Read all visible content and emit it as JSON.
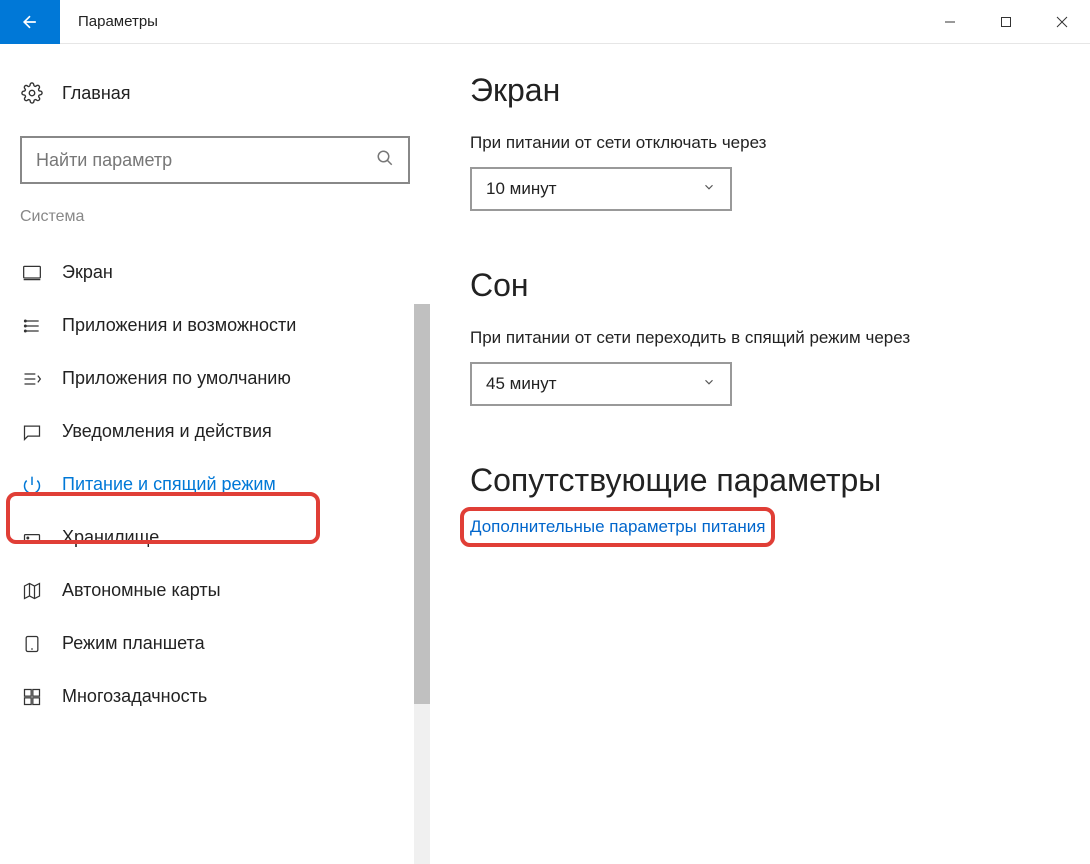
{
  "window": {
    "title": "Параметры"
  },
  "sidebar": {
    "home": "Главная",
    "search_placeholder": "Найти параметр",
    "category": "Система",
    "items": [
      {
        "label": "Экран"
      },
      {
        "label": "Приложения и возможности"
      },
      {
        "label": "Приложения по умолчанию"
      },
      {
        "label": "Уведомления и действия"
      },
      {
        "label": "Питание и спящий режим"
      },
      {
        "label": "Хранилище"
      },
      {
        "label": "Автономные карты"
      },
      {
        "label": "Режим планшета"
      },
      {
        "label": "Многозадачность"
      }
    ]
  },
  "main": {
    "screen": {
      "heading": "Экран",
      "label": "При питании от сети отключать через",
      "value": "10 минут"
    },
    "sleep": {
      "heading": "Сон",
      "label": "При питании от сети переходить в спящий режим через",
      "value": "45 минут"
    },
    "related": {
      "heading": "Сопутствующие параметры",
      "link": "Дополнительные параметры питания"
    }
  }
}
